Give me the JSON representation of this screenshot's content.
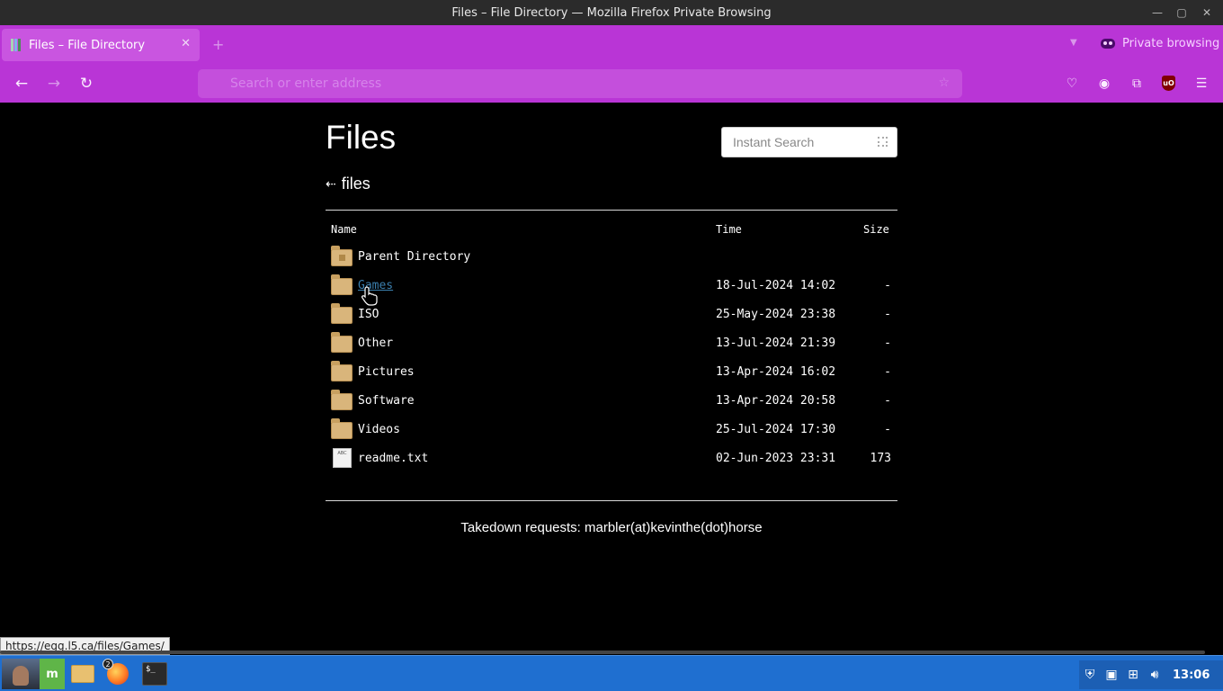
{
  "window": {
    "title": "Files – File Directory — Mozilla Firefox Private Browsing"
  },
  "tabs": {
    "active_tab_title": "Files – File Directory",
    "new_tab_label": "+",
    "private_label": "Private browsing"
  },
  "navbar": {
    "url_placeholder": "Search or enter address"
  },
  "page": {
    "title": "Files",
    "search_placeholder": "Instant Search",
    "breadcrumb_arrow": "⇠",
    "breadcrumb": "files",
    "columns": {
      "name": "Name",
      "time": "Time",
      "size": "Size"
    },
    "rows": [
      {
        "name": "Parent Directory",
        "time": "",
        "size": "",
        "type": "parent"
      },
      {
        "name": "Games",
        "time": "18-Jul-2024 14:02",
        "size": "-",
        "type": "folder"
      },
      {
        "name": "ISO",
        "time": "25-May-2024 23:38",
        "size": "-",
        "type": "folder"
      },
      {
        "name": "Other",
        "time": "13-Jul-2024 21:39",
        "size": "-",
        "type": "folder"
      },
      {
        "name": "Pictures",
        "time": "13-Apr-2024 16:02",
        "size": "-",
        "type": "folder"
      },
      {
        "name": "Software",
        "time": "13-Apr-2024 20:58",
        "size": "-",
        "type": "folder"
      },
      {
        "name": "Videos",
        "time": "25-Jul-2024 17:30",
        "size": "-",
        "type": "folder"
      },
      {
        "name": "readme.txt",
        "time": "02-Jun-2023 23:31",
        "size": "173",
        "type": "file"
      }
    ],
    "file_icon_text": "ABC",
    "footer": "Takedown requests: marbler(at)kevinthe(dot)horse"
  },
  "status": {
    "hover_url": "https://egg.l5.ca/files/Games/"
  },
  "taskbar": {
    "mint_label": "m",
    "firefox_badge": "2",
    "terminal_prompt": "$_",
    "clock": "13:06"
  },
  "colors": {
    "browser_accent": "#b935d6",
    "link": "#3b7fae",
    "taskbar": "#1f6fd0"
  }
}
